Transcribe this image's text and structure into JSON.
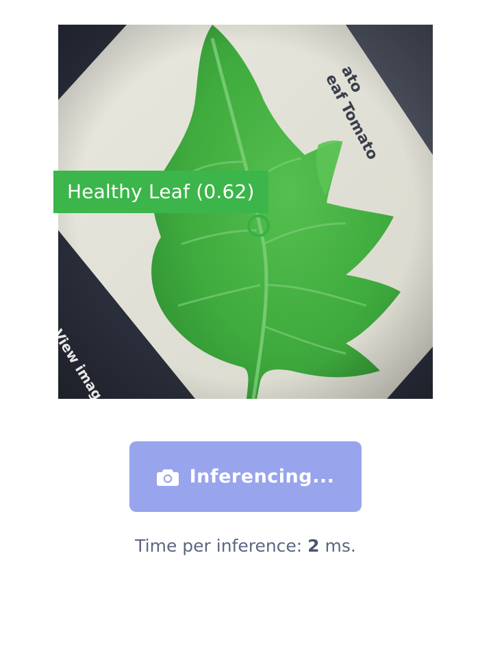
{
  "photo": {
    "caption_top_lines": [
      "ato",
      "eaf Tomato"
    ],
    "caption_bottom": "View imag"
  },
  "detection": {
    "label": "Healthy Leaf (0.62)",
    "confidence": 0.62,
    "color": "#3cb54a"
  },
  "button": {
    "icon": "camera-icon",
    "label": "Inferencing...",
    "color": "#98a4ec"
  },
  "timing": {
    "prefix": "Time per inference: ",
    "value": "2",
    "suffix": " ms."
  }
}
